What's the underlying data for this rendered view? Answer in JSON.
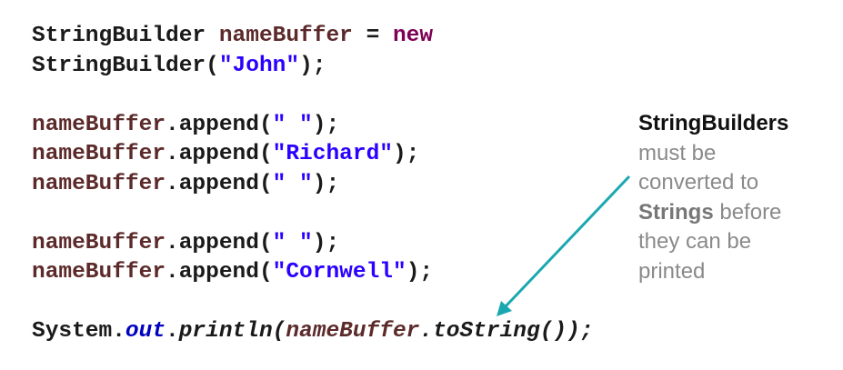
{
  "code": [
    [
      {
        "t": "StringBuilder ",
        "c": ""
      },
      {
        "t": "nameBuffer",
        "c": "t-var"
      },
      {
        "t": " = ",
        "c": ""
      },
      {
        "t": "new",
        "c": "t-kw"
      }
    ],
    [
      {
        "t": "StringBuilder(",
        "c": ""
      },
      {
        "t": "\"John\"",
        "c": "t-str"
      },
      {
        "t": ");",
        "c": ""
      }
    ],
    [],
    [
      {
        "t": "nameBuffer",
        "c": "t-var"
      },
      {
        "t": ".append(",
        "c": ""
      },
      {
        "t": "\" \"",
        "c": "t-str"
      },
      {
        "t": ");",
        "c": ""
      }
    ],
    [
      {
        "t": "nameBuffer",
        "c": "t-var"
      },
      {
        "t": ".append(",
        "c": ""
      },
      {
        "t": "\"Richard\"",
        "c": "t-str"
      },
      {
        "t": ");",
        "c": ""
      }
    ],
    [
      {
        "t": "nameBuffer",
        "c": "t-var"
      },
      {
        "t": ".append(",
        "c": ""
      },
      {
        "t": "\" \"",
        "c": "t-str"
      },
      {
        "t": ");",
        "c": ""
      }
    ],
    [],
    [
      {
        "t": "nameBuffer",
        "c": "t-var"
      },
      {
        "t": ".append(",
        "c": ""
      },
      {
        "t": "\" \"",
        "c": "t-str"
      },
      {
        "t": ");",
        "c": ""
      }
    ],
    [
      {
        "t": "nameBuffer",
        "c": "t-var"
      },
      {
        "t": ".append(",
        "c": ""
      },
      {
        "t": "\"Cornwell\"",
        "c": "t-str"
      },
      {
        "t": ");",
        "c": ""
      }
    ],
    [],
    [
      {
        "t": "System.",
        "c": ""
      },
      {
        "t": "out",
        "c": "t-field"
      },
      {
        "t": ".",
        "c": ""
      },
      {
        "t": "println(",
        "c": "t-it"
      },
      {
        "t": "nameBuffer",
        "c": "t-itvar"
      },
      {
        "t": ".toString());",
        "c": "t-it"
      }
    ]
  ],
  "note": {
    "heading": "StringBuilders",
    "line1": "must be",
    "line2": "converted to",
    "strings_bold": "Strings",
    "line3_rest": " before",
    "line4": "they can be",
    "line5": "printed"
  },
  "colors": {
    "arrow": "#1aa8b0",
    "variable": "#5c2a2a",
    "keyword": "#7f0055",
    "string": "#2a00ff"
  },
  "icons": {
    "arrow": "arrow-down-left-icon"
  }
}
